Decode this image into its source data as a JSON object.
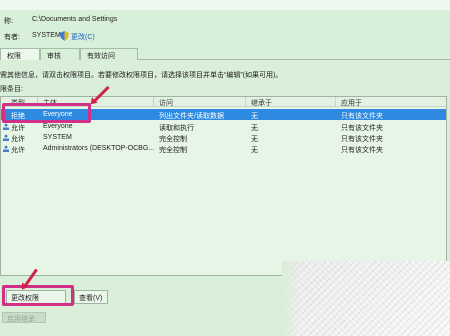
{
  "header": {
    "name_label": "称:",
    "name_value": "C:\\Documents and Settings",
    "owner_label": "有者:",
    "owner_value": "SYSTEM",
    "change_owner_link": "更改(C)"
  },
  "tabs": [
    {
      "label": "权限",
      "active": true
    },
    {
      "label": "审核",
      "active": false
    },
    {
      "label": "有效访问",
      "active": false
    }
  ],
  "hint": "需其他信息，请双击权限项目。若要修改权限项目，请选择该项目并单击“编辑”(如果可用)。",
  "entries_label": "限条目:",
  "table": {
    "columns": [
      "类型",
      "主体",
      "访问",
      "继承于",
      "应用于"
    ],
    "rows": [
      {
        "type": "拒绝",
        "principal": "Everyone",
        "access": "列出文件夹/读取数据",
        "inherit": "无",
        "applies": "只有该文件夹",
        "selected": true
      },
      {
        "type": "允许",
        "principal": "Everyone",
        "access": "读取和执行",
        "inherit": "无",
        "applies": "只有该文件夹",
        "selected": false
      },
      {
        "type": "允许",
        "principal": "SYSTEM",
        "access": "完全控制",
        "inherit": "无",
        "applies": "只有该文件夹",
        "selected": false
      },
      {
        "type": "允许",
        "principal": "Administrators (DESKTOP-OCBG...",
        "access": "完全控制",
        "inherit": "无",
        "applies": "只有该文件夹",
        "selected": false
      }
    ]
  },
  "buttons": {
    "change_permissions": "更改权限",
    "view": "查看(V)",
    "disabled": "启用继承"
  },
  "colors": {
    "background": "#d8eed8",
    "selection": "#2e8ae0",
    "highlight": "#d23086",
    "link": "#1e5fc4"
  },
  "icons": [
    "shield-icon",
    "user-icon",
    "arrow-icon"
  ]
}
